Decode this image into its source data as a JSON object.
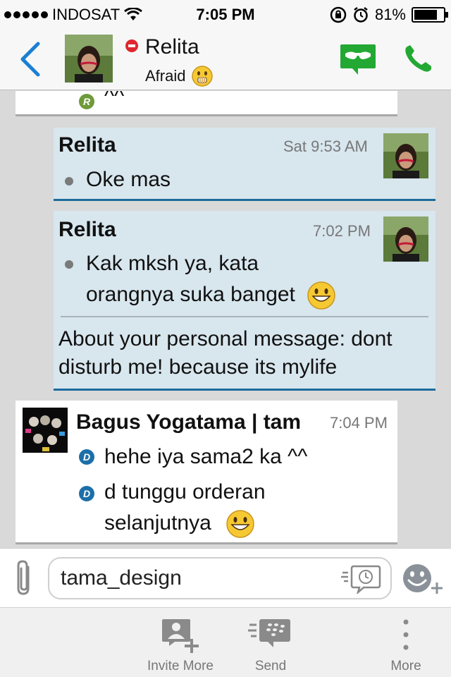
{
  "status_bar": {
    "carrier": "INDOSAT",
    "time": "7:05 PM",
    "battery": "81%",
    "battery_level": 0.81
  },
  "header": {
    "contact_name": "Relita",
    "contact_status": "Afraid",
    "presence_color": "#e0262e",
    "accent_color": "#1a7fd4",
    "action_color": "#22a833"
  },
  "messages": [
    {
      "partial_text": "^^",
      "badge": "R",
      "badge_color": "#6f9a3a"
    },
    {
      "sender": "Relita",
      "time": "Sat 9:53 AM",
      "text": "Oke mas"
    },
    {
      "sender": "Relita",
      "time": "7:02 PM",
      "line1": "Kak mksh ya, kata",
      "line2": "orangnya suka banget",
      "pm_line1": "About your personal message: dont",
      "pm_line2": "disturb me! because its mylife"
    },
    {
      "sender": "Bagus Yogatama | tam",
      "time": "7:04 PM",
      "badge": "D",
      "badge_color": "#1c6fa8",
      "text1": "hehe iya sama2 ka ^^",
      "text2_line1": "d tunggu orderan",
      "text2_line2": "selanjutnya"
    }
  ],
  "input": {
    "value": "tama_design"
  },
  "toolbar": {
    "invite_label": "Invite More",
    "send_label": "Send",
    "more_label": "More"
  }
}
